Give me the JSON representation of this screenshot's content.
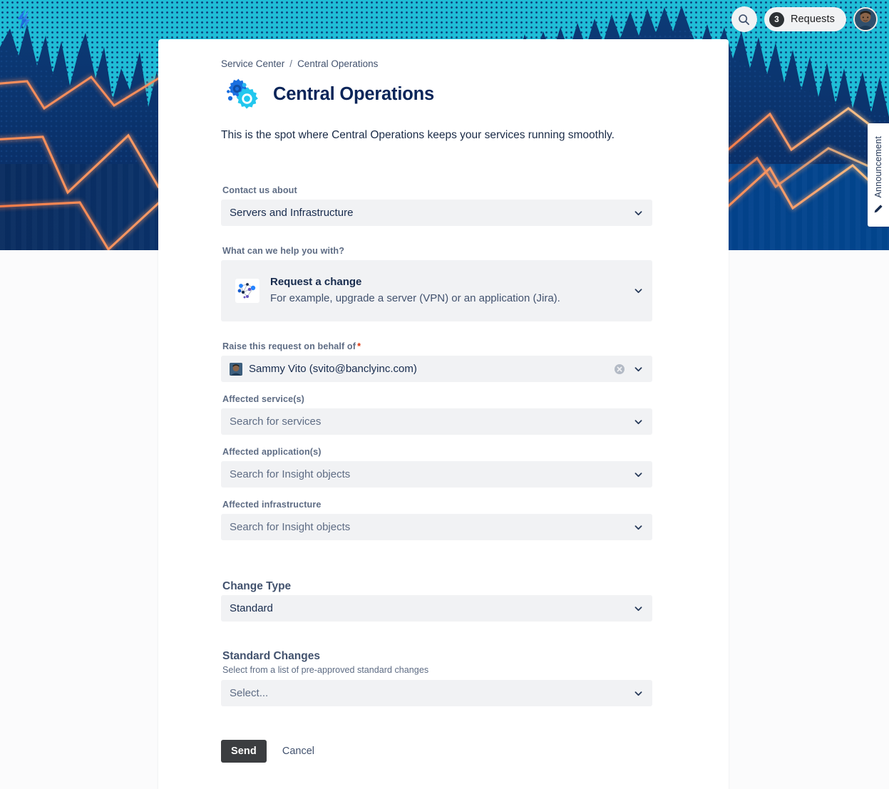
{
  "topnav": {
    "search_icon": "search-icon",
    "requests_count": "3",
    "requests_label": "Requests",
    "avatar": "user-avatar"
  },
  "announcement": {
    "label": "Announcement",
    "icon": "pencil-icon"
  },
  "breadcrumb": {
    "root": "Service Center",
    "separator": "/",
    "current": "Central Operations"
  },
  "portal": {
    "title": "Central Operations",
    "description": "This is the spot where Central Operations keeps your services running smoothly.",
    "logo_icon": "gears-icon"
  },
  "form": {
    "contact_about": {
      "label": "Contact us about",
      "value": "Servers and Infrastructure",
      "chevron_icon": "chevron-down-icon"
    },
    "help_with": {
      "label": "What can we help you with?",
      "request_type_name": "Request a change",
      "request_type_desc": "For example, upgrade a server (VPN) or an application (Jira).",
      "request_type_icon": "network-nodes-icon",
      "chevron_icon": "chevron-down-icon"
    },
    "on_behalf_of": {
      "label": "Raise this request on behalf of",
      "required_marker": "*",
      "value": "Sammy Vito (svito@banclyinc.com)",
      "clear_icon": "clear-circle-icon",
      "chevron_icon": "chevron-down-icon",
      "avatar_icon": "user-avatar-icon"
    },
    "affected_services": {
      "label": "Affected service(s)",
      "placeholder": "Search for services",
      "chevron_icon": "chevron-down-icon"
    },
    "affected_applications": {
      "label": "Affected application(s)",
      "placeholder": "Search for Insight objects",
      "chevron_icon": "chevron-down-icon"
    },
    "affected_infrastructure": {
      "label": "Affected infrastructure",
      "placeholder": "Search for Insight objects",
      "chevron_icon": "chevron-down-icon"
    },
    "change_type": {
      "label": "Change Type",
      "value": "Standard",
      "chevron_icon": "chevron-down-icon"
    },
    "standard_changes": {
      "label": "Standard Changes",
      "help": "Select from a list of pre-approved standard changes",
      "placeholder": "Select...",
      "chevron_icon": "chevron-down-icon"
    }
  },
  "actions": {
    "send_label": "Send",
    "cancel_label": "Cancel"
  },
  "colors": {
    "banner_dark": "#063a7d",
    "banner_sky": "#1fbdd6",
    "bolt_orange": "#f79765",
    "accent_navy": "#0b2559",
    "field_bg": "#f1f2f4",
    "required_red": "#de350b",
    "send_bg": "#3b3d40"
  }
}
